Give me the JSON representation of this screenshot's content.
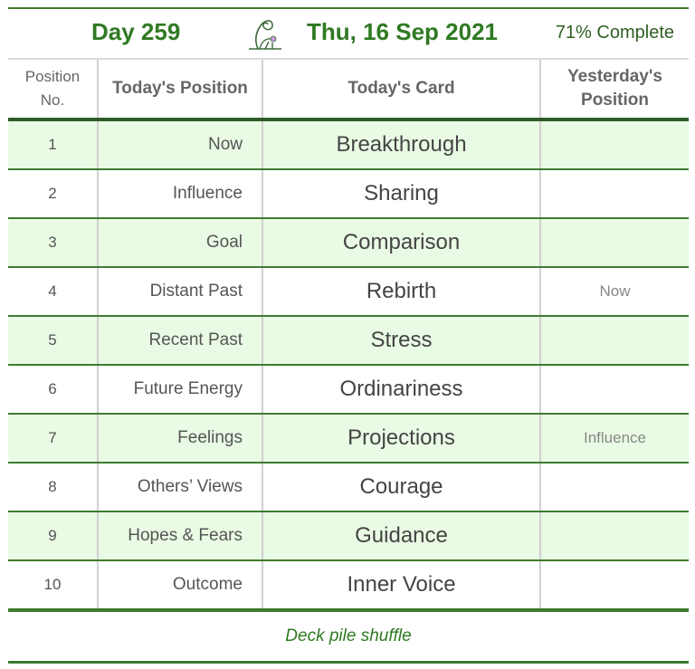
{
  "header": {
    "day": "Day 259",
    "logo_icon": "figure-logo-icon",
    "date": "Thu, 16 Sep 2021",
    "progress": "71% Complete",
    "progress_percent": 71
  },
  "table": {
    "columns": [
      "Position No.",
      "Today's Position",
      "Today's Card",
      "Yesterday's Position"
    ],
    "rows": [
      {
        "no": "1",
        "position": "Now",
        "card": "Breakthrough",
        "yesterday": ""
      },
      {
        "no": "2",
        "position": "Influence",
        "card": "Sharing",
        "yesterday": ""
      },
      {
        "no": "3",
        "position": "Goal",
        "card": "Comparison",
        "yesterday": ""
      },
      {
        "no": "4",
        "position": "Distant Past",
        "card": "Rebirth",
        "yesterday": "Now"
      },
      {
        "no": "5",
        "position": "Recent Past",
        "card": "Stress",
        "yesterday": ""
      },
      {
        "no": "6",
        "position": "Future Energy",
        "card": "Ordinariness",
        "yesterday": ""
      },
      {
        "no": "7",
        "position": "Feelings",
        "card": "Projections",
        "yesterday": "Influence"
      },
      {
        "no": "8",
        "position": "Others’ Views",
        "card": "Courage",
        "yesterday": ""
      },
      {
        "no": "9",
        "position": "Hopes & Fears",
        "card": "Guidance",
        "yesterday": ""
      },
      {
        "no": "10",
        "position": "Outcome",
        "card": "Inner Voice",
        "yesterday": ""
      }
    ]
  },
  "footer": {
    "link": "Deck pile shuffle"
  },
  "colors": {
    "accent": "#2f7a22",
    "row_highlight": "#e9fbe4",
    "rule": "#3d7a2e"
  }
}
